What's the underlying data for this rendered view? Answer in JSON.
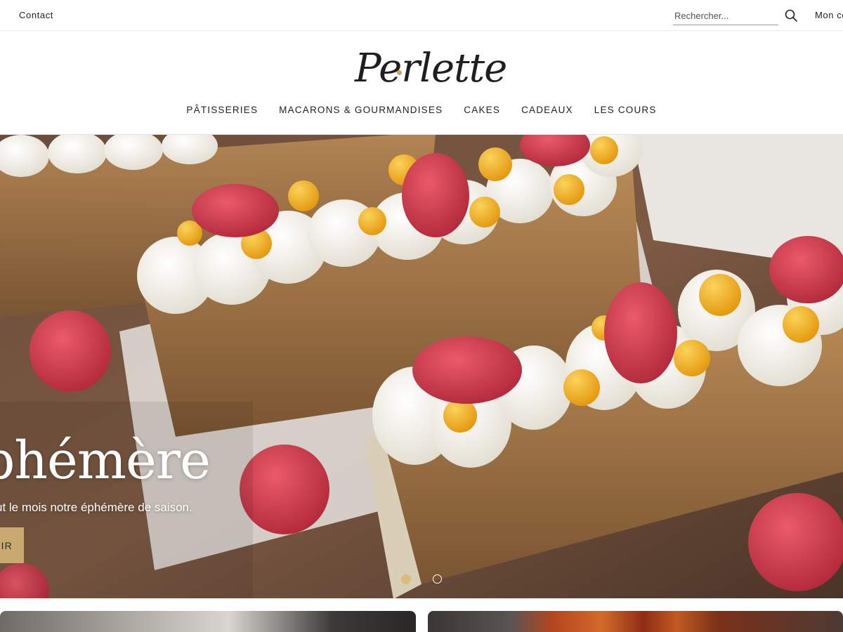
{
  "topbar": {
    "contact_label": "Contact",
    "search_placeholder": "Rechercher...",
    "search_icon": "search-icon",
    "account_label": "Mon compte"
  },
  "header": {
    "logo_text": "Perlette",
    "nav": [
      {
        "label": "PÂTISSERIES"
      },
      {
        "label": "MACARONS & GOURMANDISES"
      },
      {
        "label": "CAKES"
      },
      {
        "label": "CADEAUX"
      },
      {
        "label": "LES COURS"
      }
    ]
  },
  "hero": {
    "title": "phémère",
    "subtitle": "ut le mois notre éphémère de saison.",
    "button_label": "IR",
    "slides_total": 2,
    "active_slide": 1
  },
  "colors": {
    "accent_gold": "#c9a96e",
    "dot_active": "#d9bd7c",
    "text_dark": "#222222"
  }
}
